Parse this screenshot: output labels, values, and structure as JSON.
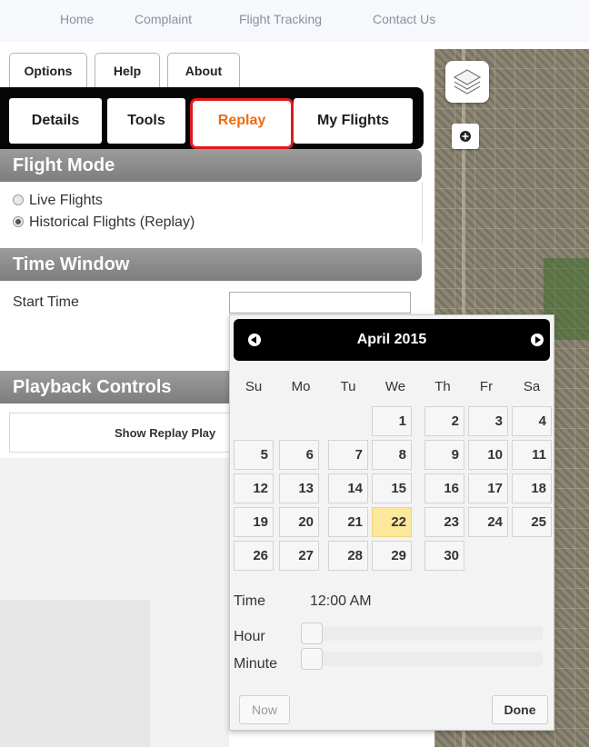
{
  "topnav": {
    "items": [
      "Home",
      "Complaint",
      "Flight Tracking",
      "Contact Us"
    ]
  },
  "options_row": {
    "items": [
      "Options",
      "Help",
      "About"
    ]
  },
  "tabs": {
    "items": [
      "Details",
      "Tools",
      "Replay",
      "My Flights"
    ],
    "active": "Replay"
  },
  "flight_mode": {
    "header": "Flight Mode",
    "options": [
      "Live Flights",
      "Historical Flights (Replay)"
    ],
    "selected": "Historical Flights (Replay)"
  },
  "time_window": {
    "header": "Time Window",
    "start_label": "Start Time",
    "start_value": ""
  },
  "playback": {
    "header": "Playback Controls",
    "button_label": "Show Replay Play"
  },
  "datepicker": {
    "month_title": "April 2015",
    "weekdays": [
      "Su",
      "Mo",
      "Tu",
      "We",
      "Th",
      "Fr",
      "Sa"
    ],
    "weeks": [
      [
        "",
        "",
        "",
        "1",
        "2",
        "3",
        "4"
      ],
      [
        "5",
        "6",
        "7",
        "8",
        "9",
        "10",
        "11"
      ],
      [
        "12",
        "13",
        "14",
        "15",
        "16",
        "17",
        "18"
      ],
      [
        "19",
        "20",
        "21",
        "22",
        "23",
        "24",
        "25"
      ],
      [
        "26",
        "27",
        "28",
        "29",
        "30",
        "",
        ""
      ]
    ],
    "highlighted_day": "22",
    "time_label": "Time",
    "time_value": "12:00 AM",
    "hour_label": "Hour",
    "minute_label": "Minute",
    "now_label": "Now",
    "done_label": "Done"
  },
  "colors": {
    "active_tab_text": "#ee6b12",
    "active_tab_border": "#e0191f",
    "today_cell": "#fbe89b",
    "section_header": "#8a8a8a"
  }
}
